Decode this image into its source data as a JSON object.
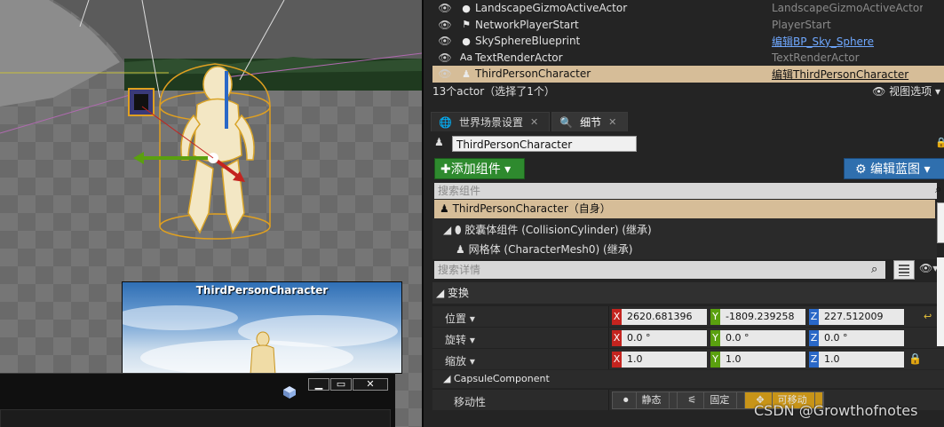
{
  "viewport": {
    "preview_title": "ThirdPersonCharacter"
  },
  "window_controls": {
    "minimize": "▁",
    "restore": "▭",
    "close": "✕"
  },
  "outliner": {
    "rows": [
      {
        "name": "LandscapeGizmoActiveActor",
        "type": "LandscapeGizmoActiveActor",
        "icon": "●",
        "link": false,
        "selected": false
      },
      {
        "name": "NetworkPlayerStart",
        "type": "PlayerStart",
        "icon": "⚑",
        "link": false,
        "selected": false
      },
      {
        "name": "SkySphereBlueprint",
        "type": "编辑BP_Sky_Sphere",
        "icon": "●",
        "link": true,
        "selected": false
      },
      {
        "name": "TextRenderActor",
        "type": "TextRenderActor",
        "icon": "Aa",
        "link": false,
        "selected": false
      },
      {
        "name": "ThirdPersonCharacter",
        "type": "编辑ThirdPersonCharacter",
        "icon": "♟",
        "link": true,
        "selected": true
      }
    ],
    "count_text": "13个actor（选择了1个）",
    "view_options": "视图选项"
  },
  "tabs": [
    {
      "label": "世界场景设置",
      "icon": "🌐"
    },
    {
      "label": "细节",
      "icon": "🔍"
    }
  ],
  "details": {
    "actor_name": "ThirdPersonCharacter",
    "add_component": "添加组件",
    "edit_blueprint": "编辑蓝图",
    "search_components_placeholder": "搜索组件",
    "self_component": "ThirdPersonCharacter（自身）",
    "component_1": "胶囊体组件 (CollisionCylinder) (继承)",
    "component_2": "网格体 (CharacterMesh0) (继承)",
    "search_details_placeholder": "搜索详情"
  },
  "transform": {
    "category": "变换",
    "location_label": "位置",
    "rotation_label": "旋转",
    "scale_label": "缩放",
    "location": {
      "x": "2620.681396",
      "y": "-1809.239258",
      "z": "227.512009"
    },
    "rotation": {
      "x": "0.0 °",
      "y": "0.0 °",
      "z": "0.0 °"
    },
    "scale": {
      "x": "1.0",
      "y": "1.0",
      "z": "1.0"
    }
  },
  "capsule": {
    "category": "CapsuleComponent",
    "mobility_label": "移动性",
    "mobility_options": [
      "静态",
      "固定",
      "可移动"
    ],
    "mobility_selected": "可移动"
  },
  "watermark": "CSDN @Growthofnotes",
  "colors": {
    "selection": "#d6bd98",
    "add_component": "#2e8a2e",
    "edit_blueprint": "#2f6fae",
    "axis_x": "#c4241f",
    "axis_y": "#5aa00f",
    "axis_z": "#2a68c7",
    "movable": "#c89418"
  }
}
